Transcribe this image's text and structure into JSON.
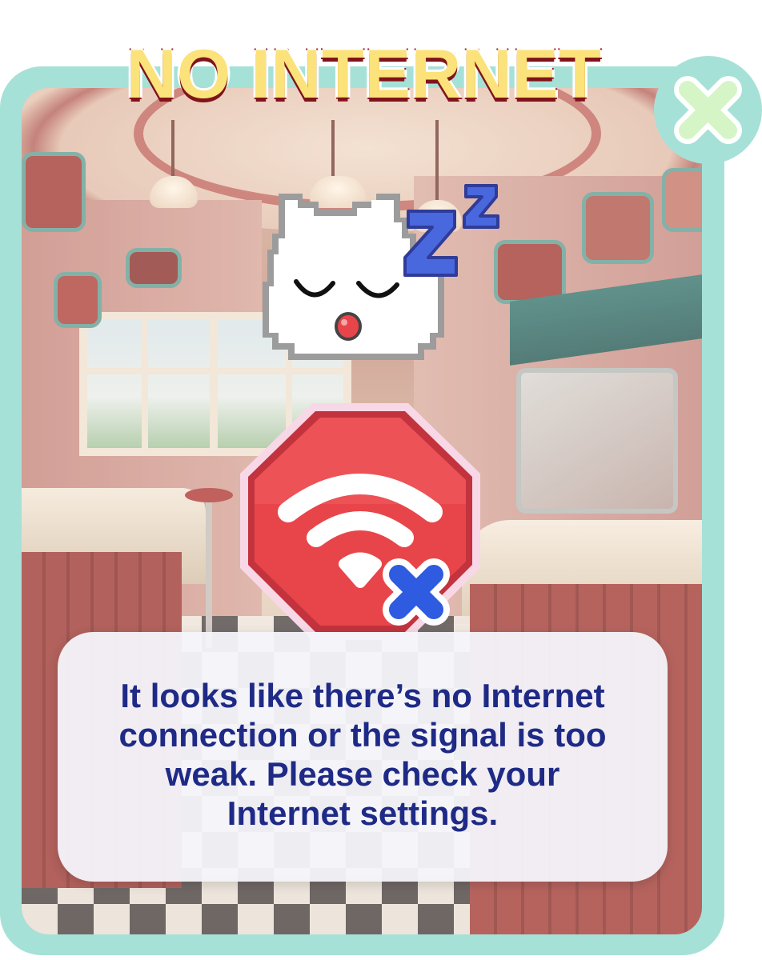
{
  "title": "NO INTERNET",
  "message": "It looks like there’s no Internet\nconnection or the signal is too\nweak. Please check your\nInternet settings.",
  "close_button": {
    "icon": "close-x-icon"
  },
  "illustrations": {
    "mascot": "sleeping-cat-icon",
    "sleep_symbol": "zzz-icon",
    "status_icon": "no-wifi-stop-sign-icon",
    "error_badge": "x-mark-icon"
  },
  "colors": {
    "frame": "#a6e1d8",
    "title_fill": "#fbe27a",
    "title_outline": "#9c1c24",
    "stop_sign": "#e8454a",
    "zzz": "#4a68de",
    "error_badge": "#2e5be0",
    "message_text": "#1e2a86",
    "close_icon": "#d6f5c7"
  },
  "background": "retro-diner-scene"
}
